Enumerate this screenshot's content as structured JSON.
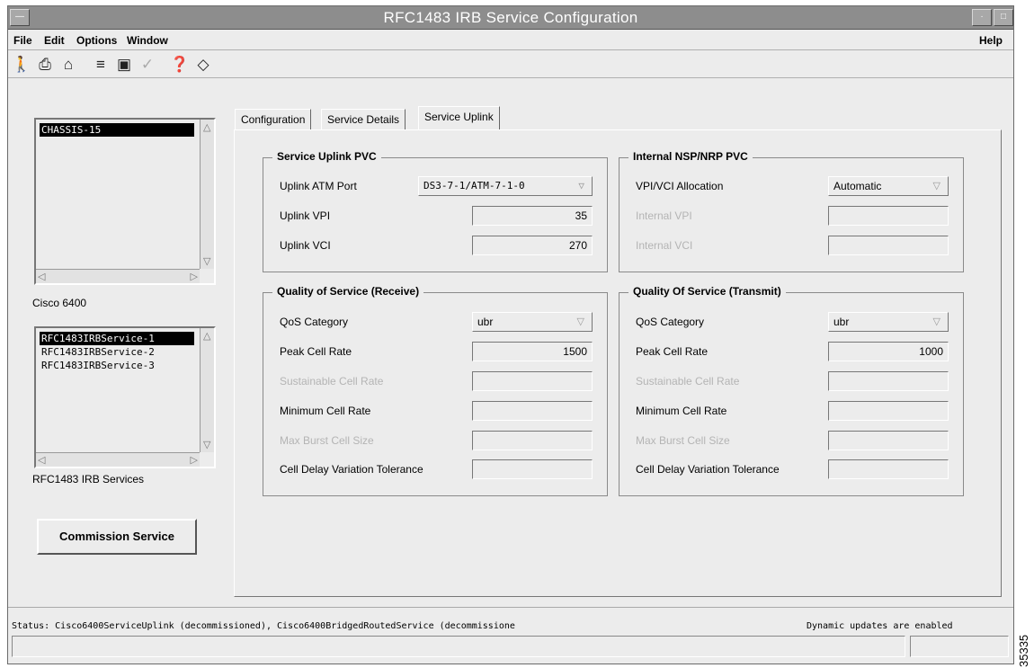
{
  "window": {
    "title": "RFC1483 IRB Service Configuration"
  },
  "menu": {
    "file": "File",
    "edit": "Edit",
    "options": "Options",
    "window": "Window",
    "help": "Help"
  },
  "toolbar": {
    "icons": [
      "exit-icon",
      "print-icon",
      "open-icon",
      "list-icon",
      "copy-icon",
      "check-icon",
      "help-icon",
      "refresh-icon"
    ]
  },
  "left": {
    "chassis_list": [
      "CHASSIS-15"
    ],
    "chassis_label": "Cisco 6400",
    "service_list": [
      "RFC1483IRBService-1",
      "RFC1483IRBService-2",
      "RFC1483IRBService-3"
    ],
    "service_label": "RFC1483 IRB Services",
    "commission_button": "Commission Service"
  },
  "tabs": [
    "Configuration",
    "Service Details",
    "Service Uplink"
  ],
  "active_tab": "Service Uplink",
  "uplink_pvc": {
    "title": "Service Uplink PVC",
    "rows": [
      {
        "label": "Uplink ATM Port",
        "value": "DS3-7-1/ATM-7-1-0",
        "kind": "select"
      },
      {
        "label": "Uplink VPI",
        "value": "35",
        "kind": "field"
      },
      {
        "label": "Uplink VCI",
        "value": "270",
        "kind": "field"
      }
    ]
  },
  "internal_pvc": {
    "title": "Internal NSP/NRP PVC",
    "rows": [
      {
        "label": "VPI/VCI Allocation",
        "value": "Automatic",
        "kind": "select"
      },
      {
        "label": "Internal VPI",
        "value": "",
        "kind": "field"
      },
      {
        "label": "Internal VCI",
        "value": "",
        "kind": "field"
      }
    ]
  },
  "qos_receive": {
    "title": "Quality of Service (Receive)",
    "rows": [
      {
        "label": "QoS Category",
        "value": "ubr",
        "kind": "select"
      },
      {
        "label": "Peak Cell Rate",
        "value": "1500",
        "kind": "field"
      },
      {
        "label": "Sustainable Cell Rate",
        "value": "",
        "kind": "field"
      },
      {
        "label": "Minimum Cell Rate",
        "value": "",
        "kind": "field"
      },
      {
        "label": "Max Burst Cell Size",
        "value": "",
        "kind": "field"
      },
      {
        "label": "Cell Delay Variation Tolerance",
        "value": "",
        "kind": "field"
      }
    ]
  },
  "qos_transmit": {
    "title": "Quality Of Service (Transmit)",
    "rows": [
      {
        "label": "QoS Category",
        "value": "ubr",
        "kind": "select"
      },
      {
        "label": "Peak Cell Rate",
        "value": "1000",
        "kind": "field"
      },
      {
        "label": "Sustainable Cell Rate",
        "value": "",
        "kind": "field"
      },
      {
        "label": "Minimum Cell Rate",
        "value": "",
        "kind": "field"
      },
      {
        "label": "Max Burst Cell Size",
        "value": "",
        "kind": "field"
      },
      {
        "label": "Cell Delay Variation Tolerance",
        "value": "",
        "kind": "field"
      }
    ]
  },
  "status": {
    "text": "Status: Cisco6400ServiceUplink (decommissioned), Cisco6400BridgedRoutedService (decommissione",
    "updates": "Dynamic updates are enabled"
  },
  "figure_id": "35335"
}
